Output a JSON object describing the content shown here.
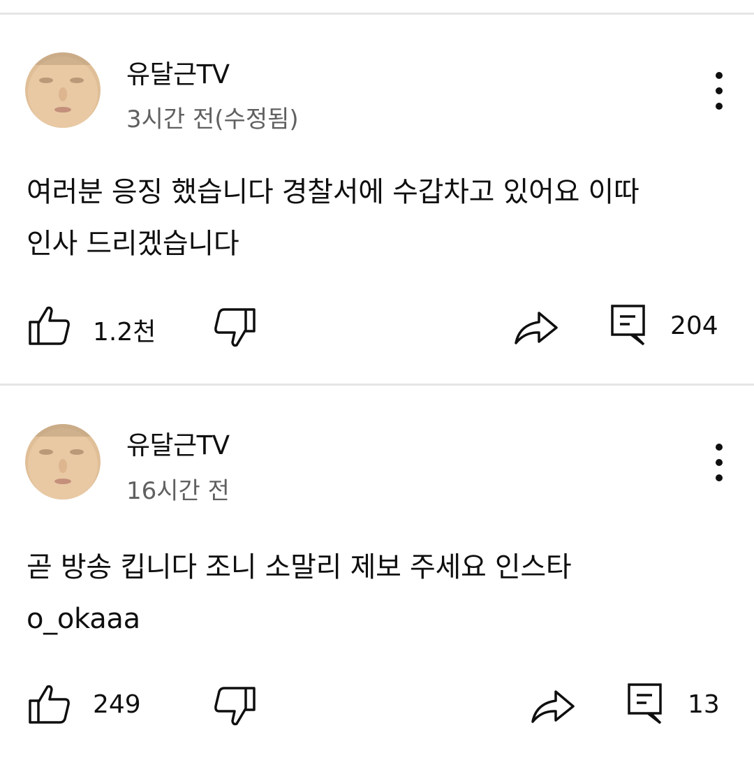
{
  "comments": [
    {
      "author": "유달근TV",
      "time": "3시간 전(수정됨)",
      "text_line1": "여러분 응징 했습니다 경찰서에 수갑차고 있어요 이따",
      "text_line2": "인사 드리겠습니다",
      "likes": "1.2천",
      "replies": "204"
    },
    {
      "author": "유달근TV",
      "time": "16시간 전",
      "text_line1": "곧 방송 킵니다 조니 소말리 제보 주세요 인스타",
      "text_line2": "o_okaaa",
      "likes": "249",
      "replies": "13"
    }
  ],
  "icons": {
    "like": "thumbs-up-icon",
    "dislike": "thumbs-down-icon",
    "share": "share-icon",
    "reply": "reply-icon",
    "more": "more-vert-icon"
  },
  "colors": {
    "text": "#0f0f0f",
    "secondary": "#606060",
    "divider": "#e5e5e5"
  }
}
